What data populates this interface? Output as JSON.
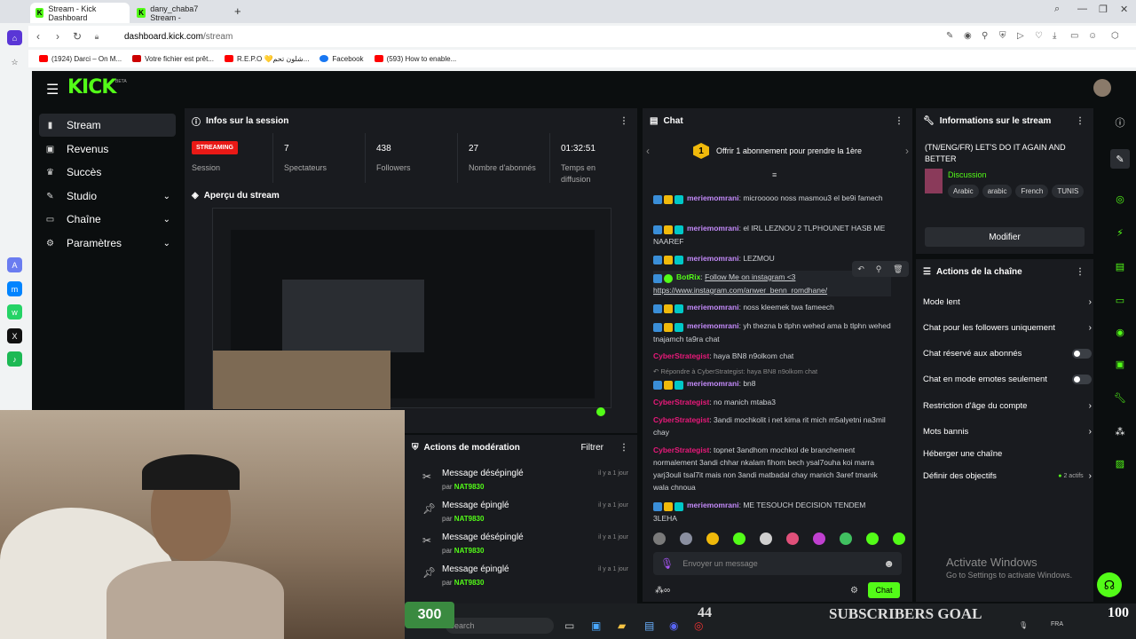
{
  "browser": {
    "tabs": [
      {
        "title": "Stream - Kick Dashboard"
      },
      {
        "title": "dany_chaba7 Stream -"
      }
    ],
    "url_host": "dashboard.kick.com",
    "url_path": "/stream",
    "bookmarks": [
      {
        "label": "(1924) Darci – On M...",
        "color": "#ff0000"
      },
      {
        "label": "Votre fichier est prêt...",
        "color": "#c00"
      },
      {
        "label": "R.E.P.O 💛شلون تحم...",
        "color": "#ff0000"
      },
      {
        "label": "Facebook",
        "color": "#1877f2"
      },
      {
        "label": "(593) How to enable...",
        "color": "#ff0000"
      }
    ]
  },
  "kick": {
    "logo": "KICK",
    "logo_sup": "BETA",
    "sidebar": [
      {
        "label": "Stream",
        "icon": "stream-icon",
        "chevron": false
      },
      {
        "label": "Revenus",
        "icon": "revenue-icon",
        "chevron": false
      },
      {
        "label": "Succès",
        "icon": "trophy-icon",
        "chevron": false
      },
      {
        "label": "Studio",
        "icon": "studio-icon",
        "chevron": true
      },
      {
        "label": "Chaîne",
        "icon": "channel-icon",
        "chevron": true
      },
      {
        "label": "Paramètres",
        "icon": "settings-icon",
        "chevron": true
      }
    ],
    "session": {
      "title": "Infos sur la session",
      "badge": "STREAMING",
      "badge_label": "Session",
      "stats": [
        {
          "value": "7",
          "label": "Spectateurs"
        },
        {
          "value": "438",
          "label": "Followers"
        },
        {
          "value": "27",
          "label": "Nombre d'abonnés"
        },
        {
          "value": "01:32:51",
          "label": "Temps en diffusion"
        }
      ]
    },
    "preview_title": "Aperçu du stream",
    "chat": {
      "title": "Chat",
      "pinned": "Offrir 1 abonnement pour prendre la 1ère",
      "pinned_num": "1",
      "messages": [
        {
          "user": "meriemomrani",
          "color": "#c38af9",
          "text": "microoooo noss masmou3 el be9i famech"
        },
        {
          "user": "meriemomrani",
          "color": "#c38af9",
          "text": "el IRL LEZNOU 2 TLPHOUNET HASB ME NAAREF"
        },
        {
          "user": "meriemomrani",
          "color": "#c38af9",
          "text": "LEZMOU"
        },
        {
          "user": "BotRix",
          "color": "#53fc18",
          "text": "Follow Me on instagram <3 https://www.instagram.com/anwer_benn_romdhane/"
        },
        {
          "user": "meriemomrani",
          "color": "#c38af9",
          "text": "noss kleemek twa fameech"
        },
        {
          "user": "meriemomrani",
          "color": "#c38af9",
          "text": "yh thezna b tlphn wehed ama b tlphn wehed tnajamch ta9ra chat"
        },
        {
          "user": "CyberStrategist",
          "color": "#e9197a",
          "text": "haya BN8 n9olkom chat"
        },
        {
          "user": "meriemomrani",
          "color": "#c38af9",
          "text": "bn8"
        },
        {
          "user": "CyberStrategist",
          "color": "#e9197a",
          "text": "no manich mtaba3"
        },
        {
          "user": "CyberStrategist",
          "color": "#e9197a",
          "text": "3andi mochkolit i net kima rit mich m5alyetni na3mil chay"
        },
        {
          "user": "CyberStrategist",
          "color": "#e9197a",
          "text": "topnet 3andhom mochkol de branchement normalement 3andi chhar nkalam fihom bech ysal7ouha koi marra yarj3ouli tsal7it mais non 3andi matbadal chay manich 3aref tmanik wala chnoua"
        },
        {
          "user": "meriemomrani",
          "color": "#c38af9",
          "text": "ME TESOUCH DECISION TENDEM 3LEHA"
        }
      ],
      "reply_note": "Répondre à CyberStrategist: haya BN8 n9olkom chat",
      "placeholder": "Envoyer un message",
      "send_label": "Chat"
    },
    "stream_info": {
      "title": "Informations sur le stream",
      "stream_title": "(TN/ENG/FR) LET'S DO IT AGAIN AND BETTER",
      "category": "Discussion",
      "tags": [
        "Arabic",
        "arabic",
        "French",
        "TUNIS"
      ],
      "modify": "Modifier"
    },
    "channel_actions": {
      "title": "Actions de la chaîne",
      "items": [
        {
          "label": "Mode lent",
          "type": "chevron"
        },
        {
          "label": "Chat pour les followers uniquement",
          "type": "chevron"
        },
        {
          "label": "Chat réservé aux abonnés",
          "type": "toggle"
        },
        {
          "label": "Chat en mode emotes seulement",
          "type": "toggle"
        },
        {
          "label": "Restriction d'âge du compte",
          "type": "chevron"
        },
        {
          "label": "Mots bannis",
          "type": "chevron"
        },
        {
          "label": "Héberger une chaîne",
          "type": "none"
        },
        {
          "label": "Définir des objectifs",
          "type": "chevron",
          "extra": "2 actifs"
        }
      ]
    },
    "moderation": {
      "title": "Actions de modération",
      "filter": "Filtrer",
      "items": [
        {
          "action": "Message désépinglé",
          "by": "par",
          "user": "NAT9830",
          "date": "il y a 1 jour"
        },
        {
          "action": "Message épinglé",
          "by": "par",
          "user": "NAT9830",
          "date": "il y a 1 jour"
        },
        {
          "action": "Message désépinglé",
          "by": "par",
          "user": "NAT9830",
          "date": "il y a 1 jour"
        },
        {
          "action": "Message épinglé",
          "by": "par",
          "user": "NAT9830",
          "date": "il y a 1 jour"
        }
      ]
    }
  },
  "overlay": {
    "goal_left": "300",
    "goal_current": "44",
    "goal_title": "SUBSCRIBERS GOAL",
    "goal_target": "100",
    "search": "Search",
    "activate_title": "Activate Windows",
    "activate_sub": "Go to Settings to activate Windows."
  }
}
